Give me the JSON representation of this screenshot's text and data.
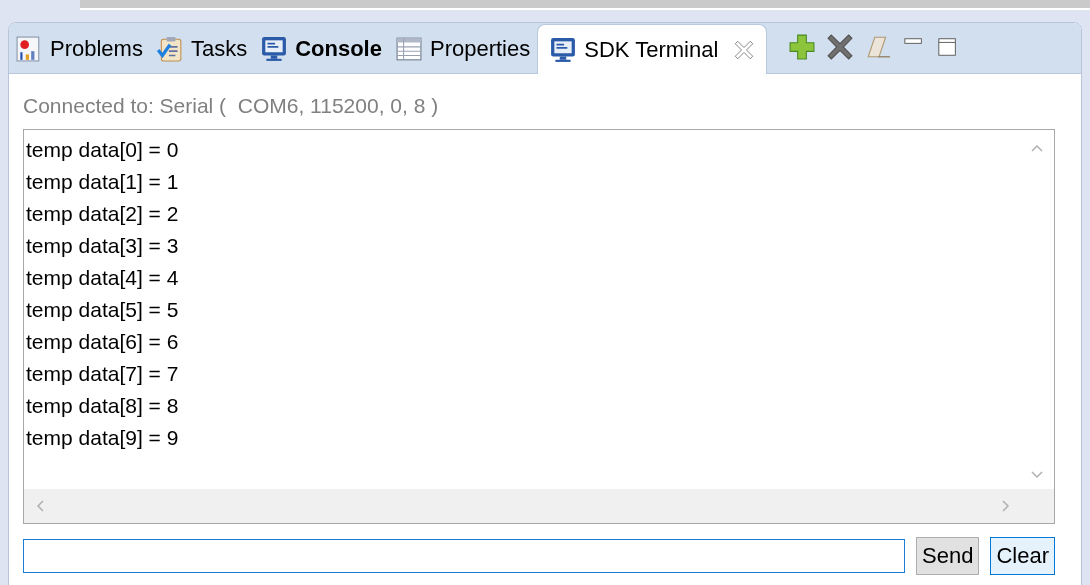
{
  "tabs": [
    {
      "label": "Problems",
      "kind": "problems",
      "selected": false,
      "emphasized": false,
      "closable": false
    },
    {
      "label": "Tasks",
      "kind": "tasks",
      "selected": false,
      "emphasized": false,
      "closable": false
    },
    {
      "label": "Console",
      "kind": "monitor",
      "selected": false,
      "emphasized": true,
      "closable": false
    },
    {
      "label": "Properties",
      "kind": "table",
      "selected": false,
      "emphasized": false,
      "closable": false
    },
    {
      "label": "SDK Terminal",
      "kind": "monitor",
      "selected": true,
      "emphasized": false,
      "closable": true
    }
  ],
  "status": "Connected to: Serial (  COM6, 115200, 0, 8 )",
  "output_lines": [
    "temp data[0] = 0",
    "temp data[1] = 1",
    "temp data[2] = 2",
    "temp data[3] = 3",
    "temp data[4] = 4",
    "temp data[5] = 5",
    "temp data[6] = 6",
    "temp data[7] = 7",
    "temp data[8] = 8",
    "temp data[9] = 9"
  ],
  "buttons": [
    "Send",
    "Clear"
  ]
}
